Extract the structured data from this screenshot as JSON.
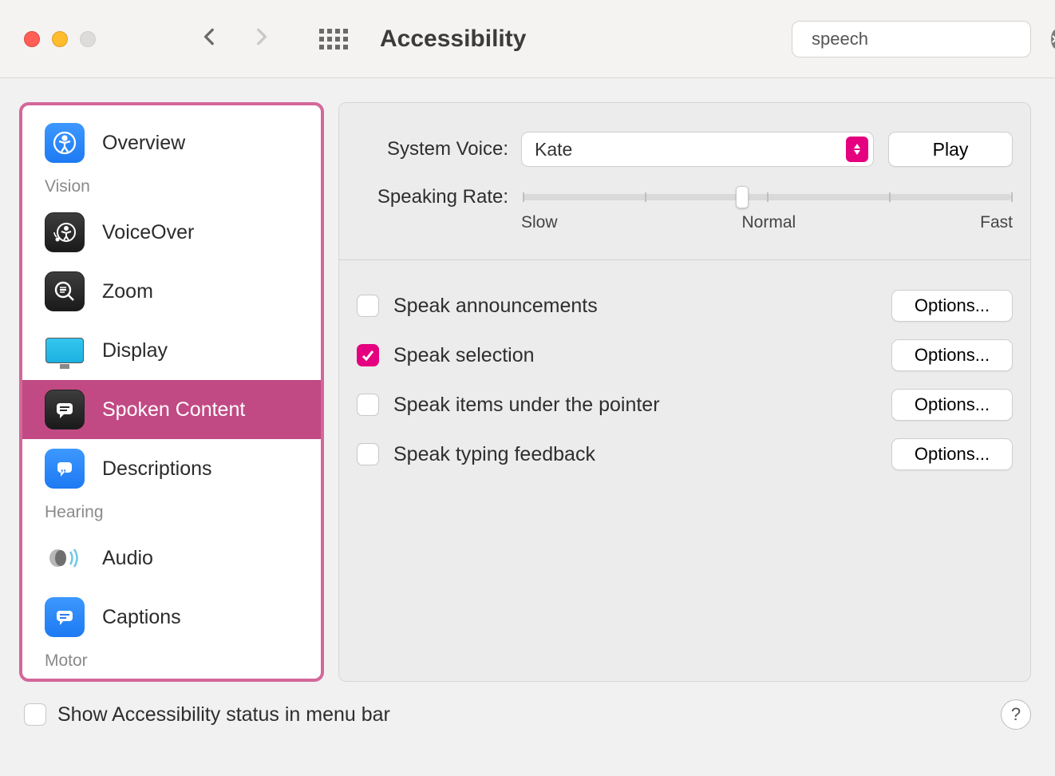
{
  "window": {
    "title": "Accessibility"
  },
  "search": {
    "value": "speech"
  },
  "sidebar": {
    "items": [
      {
        "label": "Overview"
      },
      {
        "label": "VoiceOver"
      },
      {
        "label": "Zoom"
      },
      {
        "label": "Display"
      },
      {
        "label": "Spoken Content"
      },
      {
        "label": "Descriptions"
      },
      {
        "label": "Audio"
      },
      {
        "label": "Captions"
      }
    ],
    "sections": {
      "vision": "Vision",
      "hearing": "Hearing",
      "motor": "Motor"
    }
  },
  "panel": {
    "system_voice_label": "System Voice:",
    "system_voice_value": "Kate",
    "play_label": "Play",
    "rate_label": "Speaking Rate:",
    "rate_slow": "Slow",
    "rate_normal": "Normal",
    "rate_fast": "Fast",
    "checks": [
      {
        "label": "Speak announcements",
        "options": "Options..."
      },
      {
        "label": "Speak selection",
        "options": "Options..."
      },
      {
        "label": "Speak items under the pointer",
        "options": "Options..."
      },
      {
        "label": "Speak typing feedback",
        "options": "Options..."
      }
    ]
  },
  "footer": {
    "label": "Show Accessibility status in menu bar",
    "help": "?"
  }
}
